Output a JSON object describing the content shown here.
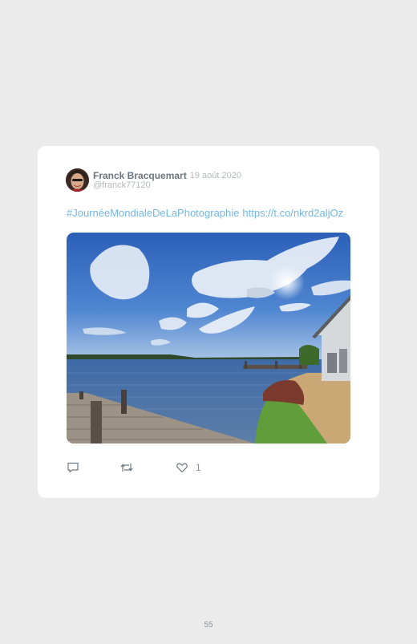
{
  "tweet": {
    "author_name": "Franck Bracquemart",
    "date": "· 19 août 2020",
    "handle": "@franck77120",
    "hashtag": "#JournéeMondialeDeLaPhotographie",
    "link": "https://t.co/nkrd2aljOz",
    "like_count": "1"
  },
  "icons": {
    "reply": "reply-icon",
    "retweet": "retweet-icon",
    "like": "heart-icon"
  },
  "colors": {
    "link": "#71b8e8",
    "name": "#6b7680",
    "muted": "#b3b8bd",
    "background": "#ebebeb",
    "card": "#ffffff"
  },
  "page": {
    "number": "55"
  }
}
